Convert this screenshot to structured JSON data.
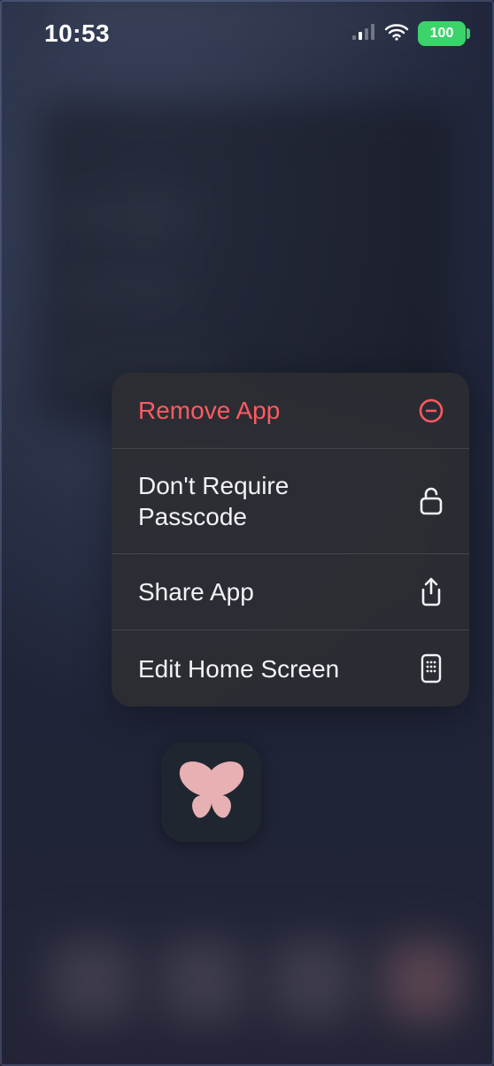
{
  "status_bar": {
    "time": "10:53",
    "battery_percent": "100"
  },
  "context_menu": {
    "items": [
      {
        "label": "Remove App",
        "icon": "minus-circle-icon",
        "destructive": true
      },
      {
        "label": "Don't Require Passcode",
        "icon": "lock-open-icon",
        "destructive": false
      },
      {
        "label": "Share App",
        "icon": "share-icon",
        "destructive": false
      },
      {
        "label": "Edit Home Screen",
        "icon": "apps-grid-icon",
        "destructive": false
      }
    ]
  },
  "app_icon": {
    "name": "butterfly-icon",
    "color": "#e7b0b3"
  }
}
